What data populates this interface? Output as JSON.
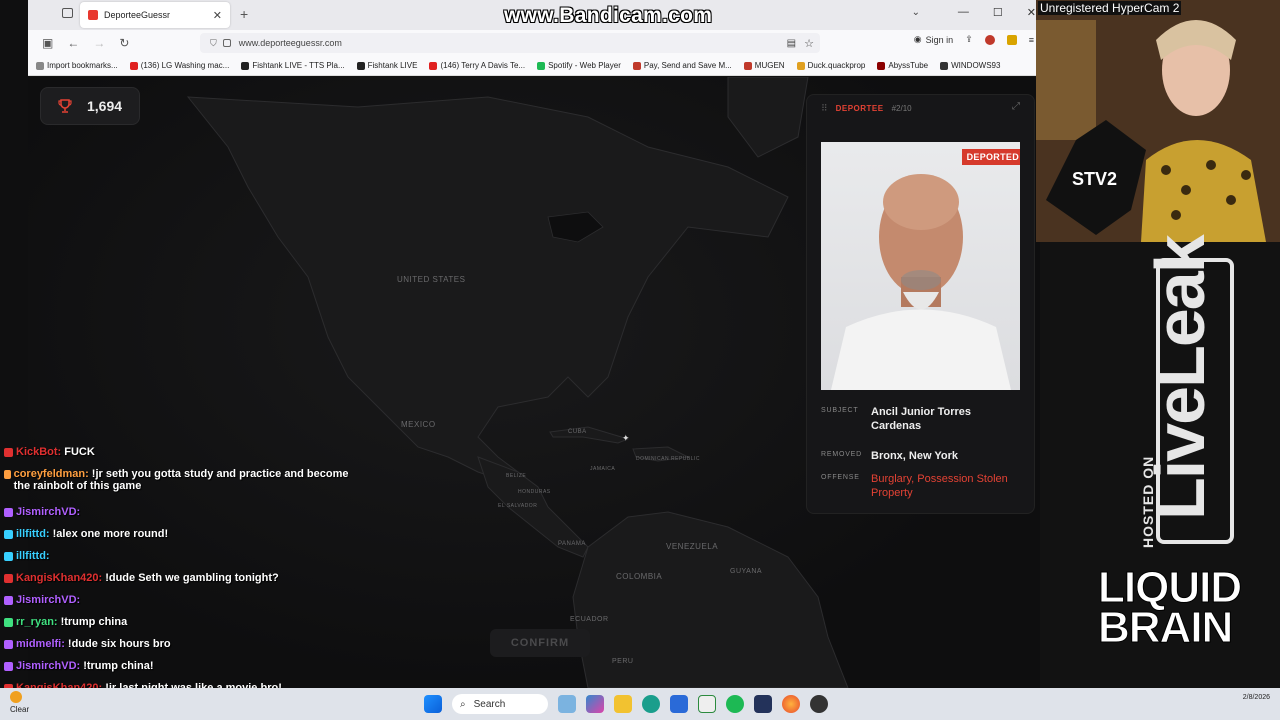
{
  "overlay": {
    "recorder_watermark": "www.Bandicam.com",
    "hypercam_watermark": "Unregistered HyperCam 2",
    "hosted_on": "HOSTED ON",
    "liveleak": "LiveLeak",
    "liquid_brain": "LIQUID BRAIN"
  },
  "browser": {
    "tab_title": "DeporteeGuessr",
    "url": "www.deporteeguessr.com",
    "signin_label": "Sign in",
    "bookmarks": [
      {
        "label": "Import bookmarks...",
        "color": "#888888"
      },
      {
        "label": "(136) LG Washing mac...",
        "color": "#e02020"
      },
      {
        "label": "Fishtank LIVE - TTS Pla...",
        "color": "#222222"
      },
      {
        "label": "Fishtank LIVE",
        "color": "#222222"
      },
      {
        "label": "(146) Terry A Davis Te...",
        "color": "#e02020"
      },
      {
        "label": "Spotify - Web Player",
        "color": "#1db954"
      },
      {
        "label": "Pay, Send and Save M...",
        "color": "#c0392b"
      },
      {
        "label": "MUGEN",
        "color": "#c0392b"
      },
      {
        "label": "Duck.quackprop",
        "color": "#e0a020"
      },
      {
        "label": "AbyssTube",
        "color": "#8b0000"
      },
      {
        "label": "WINDOWS93",
        "color": "#333333"
      }
    ]
  },
  "game": {
    "score": "1,694",
    "confirm_label": "CONFIRM",
    "map_labels": [
      "UNITED STATES",
      "MEXICO",
      "CUBA",
      "JAMAICA",
      "DOMINICAN REPUBLIC",
      "BELIZE",
      "HONDURAS",
      "EL SALVADOR",
      "PANAMA",
      "VENEZUELA",
      "GUYANA",
      "COLOMBIA",
      "ECUADOR",
      "PERU"
    ]
  },
  "card": {
    "title": "DEPORTEE",
    "counter": "#2/10",
    "badge": "DEPORTED",
    "subject_label": "SUBJECT",
    "subject": "Ancil Junior Torres Cardenas",
    "removed_label": "REMOVED",
    "removed": "Bronx, New York",
    "offense_label": "OFFENSE",
    "offense": "Burglary, Possession Stolen Property"
  },
  "chat": [
    {
      "user": "KickBot:",
      "text": "FUCK",
      "color": "#e03030"
    },
    {
      "user": "coreyfeldman:",
      "text": "!jr seth you gotta study and practice and become the rainbolt of this game",
      "color": "#ff9f40"
    },
    {
      "user": "JismirchVD:",
      "text": "",
      "color": "#b060ff"
    },
    {
      "user": "illfittd:",
      "text": "!alex one more round!",
      "color": "#38d0ff"
    },
    {
      "user": "illfittd:",
      "text": "",
      "color": "#38d0ff"
    },
    {
      "user": "KangisKhan420:",
      "text": "!dude Seth we gambling tonight?",
      "color": "#e03030"
    },
    {
      "user": "JismirchVD:",
      "text": "",
      "color": "#b060ff"
    },
    {
      "user": "rr_ryan:",
      "text": "!trump china",
      "color": "#40e080"
    },
    {
      "user": "midmelfi:",
      "text": "!dude six hours bro",
      "color": "#b060ff"
    },
    {
      "user": "JismirchVD:",
      "text": "!trump china!",
      "color": "#b060ff"
    },
    {
      "user": "KangisKhan420:",
      "text": "!jr last night was like a movie bro!",
      "color": "#e03030"
    }
  ],
  "taskbar": {
    "weather": "Clear",
    "search_label": "Search",
    "date": "2/8/2026"
  }
}
